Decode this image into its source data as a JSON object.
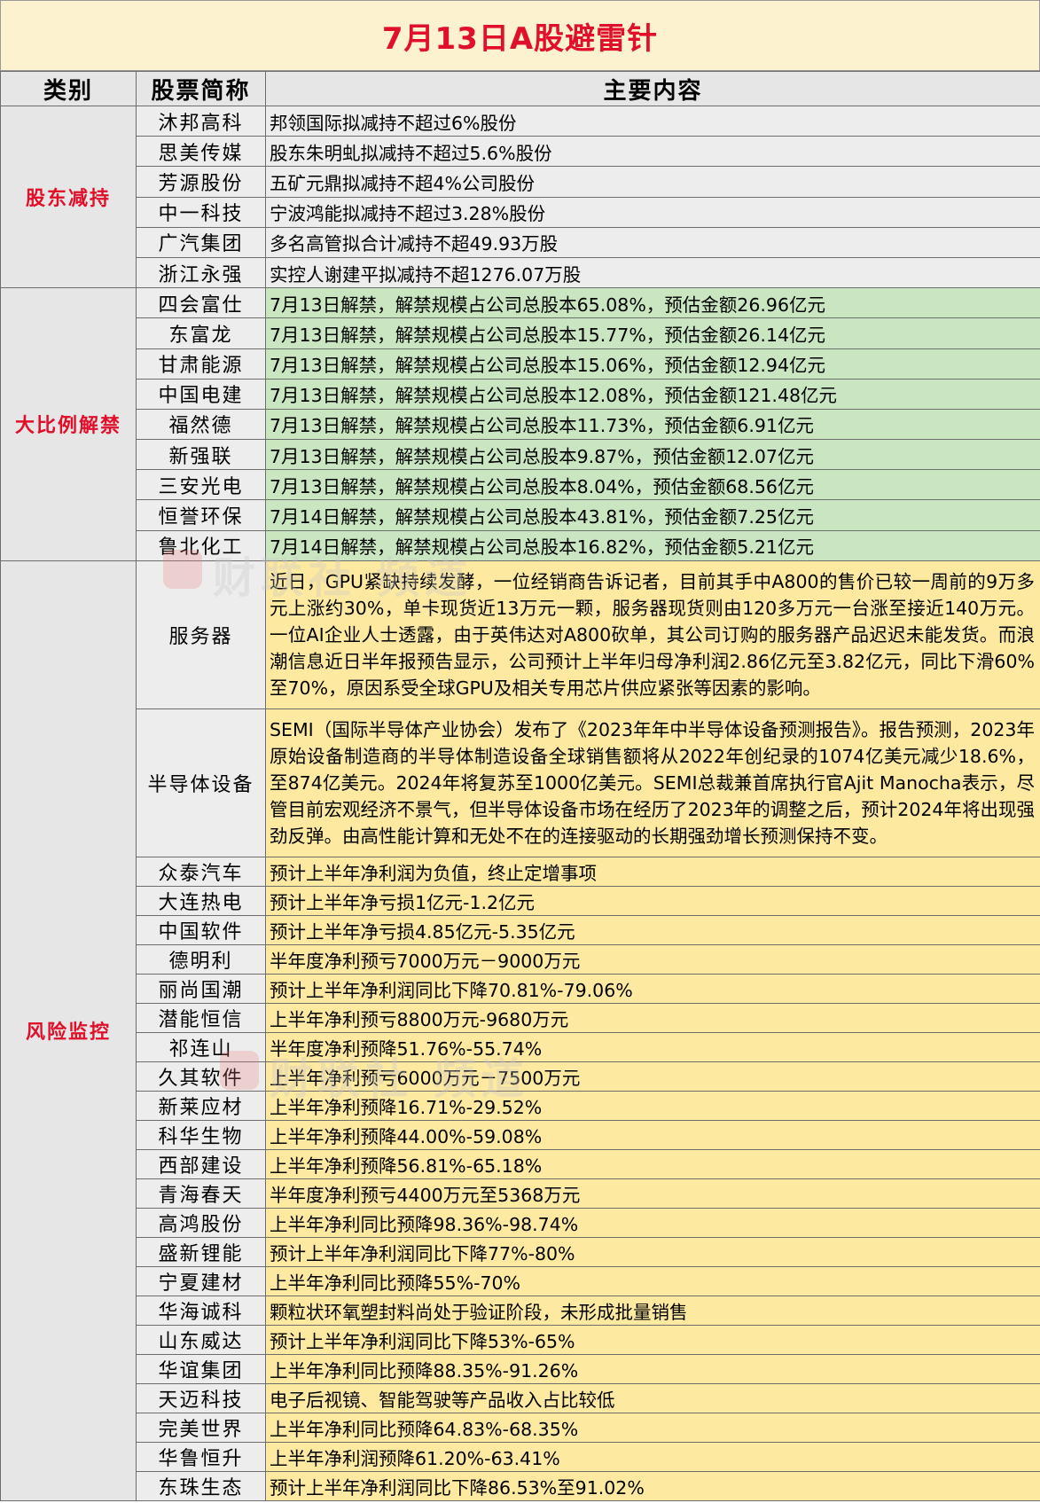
{
  "title": "7月13日A股避雷针",
  "headers": {
    "category": "类别",
    "name": "股票简称",
    "content": "主要内容"
  },
  "watermark": "财联社 频道",
  "groups": [
    {
      "category": "股东减持",
      "rows": [
        {
          "name": "沐邦高科",
          "content": "邦领国际拟减持不超过6%股份"
        },
        {
          "name": "思美传媒",
          "content": "股东朱明虬拟减持不超过5.6%股份"
        },
        {
          "name": "芳源股份",
          "content": "五矿元鼎拟减持不超4%公司股份"
        },
        {
          "name": "中一科技",
          "content": "宁波鸿能拟减持不超过3.28%股份"
        },
        {
          "name": "广汽集团",
          "content": "多名高管拟合计减持不超49.93万股"
        },
        {
          "name": "浙江永强",
          "content": "实控人谢建平拟减持不超1276.07万股"
        }
      ]
    },
    {
      "category": "大比例解禁",
      "rows": [
        {
          "name": "四会富仕",
          "content": "7月13日解禁，解禁规模占公司总股本65.08%，预估金额26.96亿元"
        },
        {
          "name": "东富龙",
          "content": "7月13日解禁，解禁规模占公司总股本15.77%，预估金额26.14亿元"
        },
        {
          "name": "甘肃能源",
          "content": "7月13日解禁，解禁规模占公司总股本15.06%，预估金额12.94亿元"
        },
        {
          "name": "中国电建",
          "content": "7月13日解禁，解禁规模占公司总股本12.08%，预估金额121.48亿元"
        },
        {
          "name": "福然德",
          "content": "7月13日解禁，解禁规模占公司总股本11.73%，预估金额6.91亿元"
        },
        {
          "name": "新强联",
          "content": "7月13日解禁，解禁规模占公司总股本9.87%，预估金额12.07亿元"
        },
        {
          "name": "三安光电",
          "content": "7月13日解禁，解禁规模占公司总股本8.04%，预估金额68.56亿元"
        },
        {
          "name": "恒誉环保",
          "content": "7月14日解禁，解禁规模占公司总股本43.81%，预估金额7.25亿元"
        },
        {
          "name": "鲁北化工",
          "content": "7月14日解禁，解禁规模占公司总股本16.82%，预估金额5.21亿元"
        }
      ]
    },
    {
      "category": "风险监控",
      "paras": [
        {
          "name": "服务器",
          "content": "近日，GPU紧缺持续发酵，一位经销商告诉记者，目前其手中A800的售价已较一周前的9万多元上涨约30%，单卡现货近13万元一颗，服务器现货则由120多万元一台涨至接近140万元。一位AI企业人士透露，由于英伟达对A800砍单，其公司订购的服务器产品迟迟未能发货。而浪潮信息近日半年报预告显示，公司预计上半年归母净利润2.86亿元至3.82亿元，同比下滑60%至70%，原因系受全球GPU及相关专用芯片供应紧张等因素的影响。"
        },
        {
          "name": "半导体设备",
          "content": "SEMI（国际半导体产业协会）发布了《2023年年中半导体设备预测报告》。报告预测，2023年原始设备制造商的半导体制造设备全球销售额将从2022年创纪录的1074亿美元减少18.6%，至874亿美元。2024年将复苏至1000亿美元。SEMI总裁兼首席执行官Ajit Manocha表示，尽管目前宏观经济不景气，但半导体设备市场在经历了2023年的调整之后，预计2024年将出现强劲反弹。由高性能计算和无处不在的连接驱动的长期强劲增长预测保持不变。"
        }
      ],
      "rows": [
        {
          "name": "众泰汽车",
          "content": "预计上半年净利润为负值，终止定增事项"
        },
        {
          "name": "大连热电",
          "content": "预计上半年净亏损1亿元-1.2亿元"
        },
        {
          "name": "中国软件",
          "content": "预计上半年净亏损4.85亿元-5.35亿元"
        },
        {
          "name": "德明利",
          "content": "半年度净利预亏7000万元－9000万元"
        },
        {
          "name": "丽尚国潮",
          "content": "预计上半年净利润同比下降70.81%-79.06%"
        },
        {
          "name": "潜能恒信",
          "content": "上半年净利预亏8800万元-9680万元"
        },
        {
          "name": "祁连山",
          "content": "半年度净利预降51.76%-55.74%"
        },
        {
          "name": "久其软件",
          "content": "上半年净利预亏6000万元－7500万元"
        },
        {
          "name": "新莱应材",
          "content": "上半年净利预降16.71%-29.52%"
        },
        {
          "name": "科华生物",
          "content": "上半年净利预降44.00%-59.08%"
        },
        {
          "name": "西部建设",
          "content": "上半年净利预降56.81%-65.18%"
        },
        {
          "name": "青海春天",
          "content": "半年度净利预亏4400万元至5368万元"
        },
        {
          "name": "高鸿股份",
          "content": "上半年净利同比预降98.36%-98.74%"
        },
        {
          "name": "盛新锂能",
          "content": "预计上半年净利润同比下降77%-80%"
        },
        {
          "name": "宁夏建材",
          "content": "上半年净利同比预降55%-70%"
        },
        {
          "name": "华海诚科",
          "content": "颗粒状环氧塑封料尚处于验证阶段，未形成批量销售"
        },
        {
          "name": "山东威达",
          "content": "预计上半年净利润同比下降53%-65%"
        },
        {
          "name": "华谊集团",
          "content": "上半年净利同比预降88.35%-91.26%"
        },
        {
          "name": "天迈科技",
          "content": "电子后视镜、智能驾驶等产品收入占比较低"
        },
        {
          "name": "完美世界",
          "content": "上半年净利同比预降64.83%-68.35%"
        },
        {
          "name": "华鲁恒升",
          "content": "上半年净利润预降61.20%-63.41%"
        },
        {
          "name": "东珠生态",
          "content": "预计上半年净利润同比下降86.53%至91.02%"
        }
      ]
    }
  ]
}
